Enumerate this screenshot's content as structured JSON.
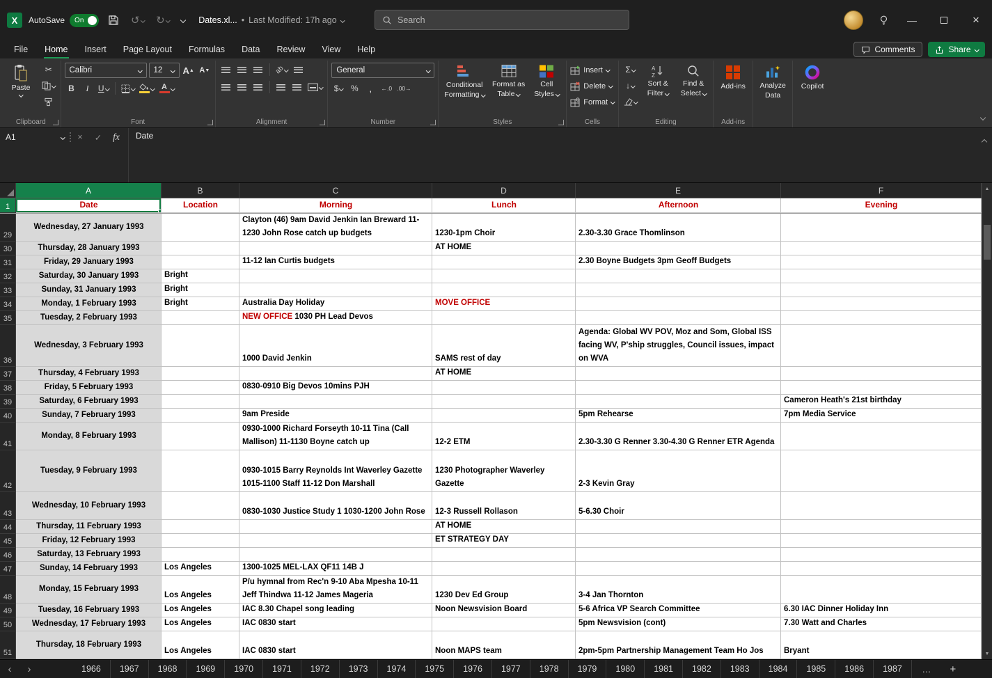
{
  "colors": {
    "accent_green": "#107c41",
    "header_red": "#c00000",
    "date_fill": "#d9d9d9"
  },
  "titlebar": {
    "autosave_label": "AutoSave",
    "autosave_state": "On",
    "doc_name": "Dates.xl...",
    "doc_modified": "Last Modified: 17h ago",
    "search_placeholder": "Search"
  },
  "menubar": {
    "items": [
      "File",
      "Home",
      "Insert",
      "Page Layout",
      "Formulas",
      "Data",
      "Review",
      "View",
      "Help"
    ],
    "active_index": 1,
    "comments": "Comments",
    "share": "Share"
  },
  "ribbon": {
    "paste": "Paste",
    "clipboard_label": "Clipboard",
    "font_name": "Calibri",
    "font_size": "12",
    "font_label": "Font",
    "alignment_label": "Alignment",
    "number_format": "General",
    "number_label": "Number",
    "conditional_1": "Conditional",
    "conditional_2": "Formatting",
    "table_1": "Format as",
    "table_2": "Table",
    "styles_1": "Cell",
    "styles_2": "Styles",
    "styles_label": "Styles",
    "insert": "Insert",
    "delete": "Delete",
    "format": "Format",
    "cells_label": "Cells",
    "sort_1": "Sort &",
    "sort_2": "Filter",
    "find_1": "Find &",
    "find_2": "Select",
    "editing_label": "Editing",
    "addins": "Add-ins",
    "addins_label": "Add-ins",
    "analyze_1": "Analyze",
    "analyze_2": "Data",
    "copilot": "Copilot"
  },
  "formula_bar": {
    "name_box": "A1",
    "fx": "fx",
    "content": "Date"
  },
  "grid": {
    "columns": [
      "A",
      "B",
      "C",
      "D",
      "E",
      "F"
    ],
    "selected_column": "A",
    "header_row": {
      "n": "1",
      "cells": [
        "Date",
        "Location",
        "Morning",
        "Lunch",
        "Afternoon",
        "Evening"
      ]
    },
    "rows": [
      {
        "n": "29",
        "h": 2,
        "cells": [
          "Wednesday, 27 January 1993",
          "",
          "Clayton (46) 9am David Jenkin Ian Breward 11-1230 John Rose catch up budgets",
          "1230-1pm Choir",
          "2.30-3.30 Grace Thomlinson",
          ""
        ]
      },
      {
        "n": "30",
        "h": 1,
        "cells": [
          "Thursday, 28 January 1993",
          "",
          "",
          "AT HOME",
          "",
          ""
        ]
      },
      {
        "n": "31",
        "h": 1,
        "cells": [
          "Friday, 29 January 1993",
          "",
          "11-12 Ian Curtis budgets",
          "",
          "2.30 Boyne Budgets 3pm Geoff Budgets",
          ""
        ]
      },
      {
        "n": "32",
        "h": 1,
        "cells": [
          "Saturday, 30 January 1993",
          "Bright",
          "",
          "",
          "",
          ""
        ]
      },
      {
        "n": "33",
        "h": 1,
        "cells": [
          "Sunday, 31 January 1993",
          "Bright",
          "",
          "",
          "",
          ""
        ]
      },
      {
        "n": "34",
        "h": 1,
        "cells": [
          "Monday, 1 February 1993",
          "Bright",
          "Australia Day Holiday",
          {
            "t": "MOVE OFFICE",
            "red": true
          },
          "",
          ""
        ]
      },
      {
        "n": "35",
        "h": 1,
        "cells": [
          "Tuesday, 2 February 1993",
          "",
          [
            {
              "t": "NEW OFFICE ",
              "red": true
            },
            {
              "t": "1030 PH Lead Devos"
            }
          ],
          "",
          "",
          ""
        ]
      },
      {
        "n": "36",
        "h": 3,
        "cells": [
          "Wednesday, 3 February 1993",
          "",
          "1000 David Jenkin",
          "SAMS rest of day",
          "Agenda: Global WV POV, Moz and Som, Global ISS facing WV, P'ship struggles, Council issues, impact on WVA",
          ""
        ]
      },
      {
        "n": "37",
        "h": 1,
        "cells": [
          "Thursday, 4 February 1993",
          "",
          "",
          "AT HOME",
          "",
          ""
        ]
      },
      {
        "n": "38",
        "h": 1,
        "cells": [
          "Friday, 5 February 1993",
          "",
          "0830-0910 Big Devos 10mins PJH",
          "",
          "",
          ""
        ]
      },
      {
        "n": "39",
        "h": 1,
        "cells": [
          "Saturday, 6 February 1993",
          "",
          "",
          "",
          "",
          "Cameron Heath's 21st birthday"
        ]
      },
      {
        "n": "40",
        "h": 1,
        "cells": [
          "Sunday, 7 February 1993",
          "",
          "9am Preside",
          "",
          "5pm Rehearse",
          "7pm Media Service"
        ]
      },
      {
        "n": "41",
        "h": 2,
        "cells": [
          "Monday, 8 February 1993",
          "",
          "0930-1000 Richard Forseyth 10-11 Tina (Call Mallison) 11-1130 Boyne catch up",
          "12-2 ETM",
          "2.30-3.30 G Renner 3.30-4.30 G Renner ETR Agenda",
          ""
        ]
      },
      {
        "n": "42",
        "h": 3,
        "cells": [
          "Tuesday, 9 February 1993",
          "",
          "0930-1015 Barry Reynolds Int Waverley Gazette 1015-1100 Staff 11-12 Don Marshall",
          "1230 Photographer Waverley Gazette",
          "2-3 Kevin Gray",
          ""
        ]
      },
      {
        "n": "43",
        "h": 2,
        "cells": [
          "Wednesday, 10 February 1993",
          "",
          "0830-1030 Justice Study 1 1030-1200 John Rose",
          "12-3 Russell Rollason",
          "5-6.30 Choir",
          ""
        ]
      },
      {
        "n": "44",
        "h": 1,
        "cells": [
          "Thursday, 11 February 1993",
          "",
          "",
          "AT HOME",
          "",
          ""
        ]
      },
      {
        "n": "45",
        "h": 1,
        "cells": [
          "Friday, 12 February 1993",
          "",
          "",
          "ET STRATEGY DAY",
          "",
          ""
        ]
      },
      {
        "n": "46",
        "h": 1,
        "cells": [
          "Saturday, 13 February 1993",
          "",
          "",
          "",
          "",
          ""
        ]
      },
      {
        "n": "47",
        "h": 1,
        "cells": [
          "Sunday, 14 February 1993",
          "Los Angeles",
          "1300-1025 MEL-LAX QF11 14B J",
          "",
          "",
          ""
        ]
      },
      {
        "n": "48",
        "h": 2,
        "cells": [
          "Monday, 15 February 1993",
          "Los Angeles",
          "P/u hymnal from Rec'n 9-10 Aba Mpesha 10-11 Jeff Thindwa 11-12 James Mageria",
          "1230 Dev Ed Group",
          "3-4 Jan Thornton",
          ""
        ]
      },
      {
        "n": "49",
        "h": 1,
        "cells": [
          "Tuesday, 16 February 1993",
          "Los Angeles",
          "IAC 8.30 Chapel song leading",
          "Noon Newsvision Board",
          "5-6 Africa VP Search Committee",
          "6.30 IAC Dinner Holiday Inn"
        ]
      },
      {
        "n": "50",
        "h": 1,
        "cells": [
          "Wednesday, 17 February 1993",
          "Los Angeles",
          "IAC 0830 start",
          "",
          "5pm Newsvision (cont)",
          "7.30 Watt and Charles"
        ]
      },
      {
        "n": "51",
        "h": 2,
        "cells": [
          "Thursday, 18 February 1993",
          "Los Angeles",
          "IAC 0830 start",
          "Noon MAPS team",
          "2pm-5pm Partnership Management Team Ho Jos",
          "Bryant"
        ]
      }
    ]
  },
  "sheet_tabs": {
    "tabs": [
      "1966",
      "1967",
      "1968",
      "1969",
      "1970",
      "1971",
      "1972",
      "1973",
      "1974",
      "1975",
      "1976",
      "1977",
      "1978",
      "1979",
      "1980",
      "1981",
      "1982",
      "1983",
      "1984",
      "1985",
      "1986",
      "1987"
    ],
    "more_label": "…",
    "add_label": "+"
  }
}
